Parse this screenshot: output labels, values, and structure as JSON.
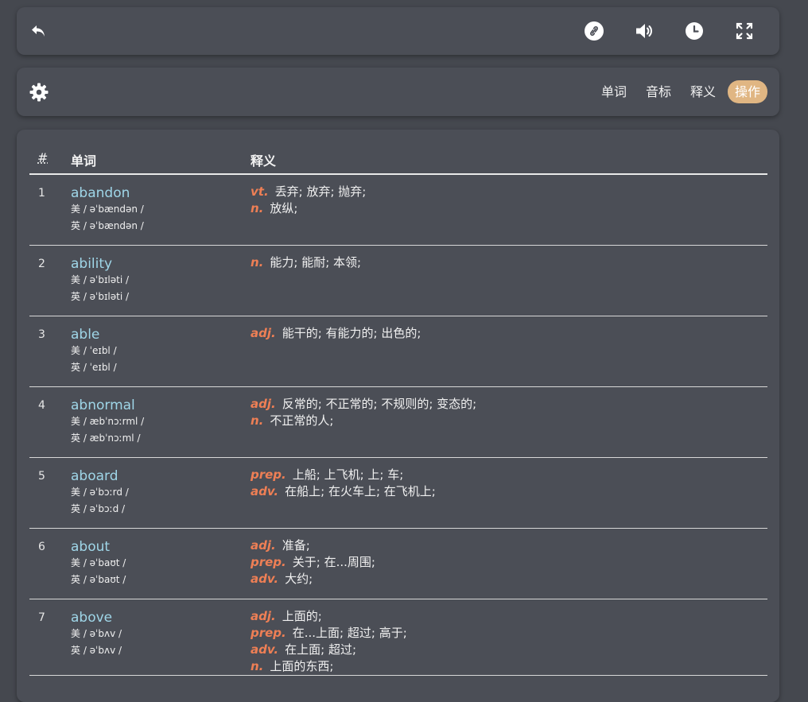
{
  "settings": {
    "tabs": [
      "单词",
      "音标",
      "释义",
      "操作"
    ],
    "active_tab": 3,
    "accent_color": "#e0b683"
  },
  "table": {
    "headers": {
      "num": "#",
      "word": "单词",
      "definition": "释义"
    },
    "rows": [
      {
        "num": "1",
        "word": "abandon",
        "us": "美 / əˈbændən /",
        "uk": "英 / əˈbændən /",
        "defs": [
          {
            "pos": "vt.",
            "text": "丢弃; 放弃; 抛弃;"
          },
          {
            "pos": "n.",
            "text": "放纵;"
          }
        ]
      },
      {
        "num": "2",
        "word": "ability",
        "us": "美 / əˈbɪləti /",
        "uk": "英 / əˈbɪləti /",
        "defs": [
          {
            "pos": "n.",
            "text": "能力; 能耐; 本领;"
          }
        ]
      },
      {
        "num": "3",
        "word": "able",
        "us": "美 / ˈeɪbl /",
        "uk": "英 / ˈeɪbl /",
        "defs": [
          {
            "pos": "adj.",
            "text": "能干的; 有能力的; 出色的;"
          }
        ]
      },
      {
        "num": "4",
        "word": "abnormal",
        "us": "美 / æbˈnɔːrml /",
        "uk": "英 / æbˈnɔːml /",
        "defs": [
          {
            "pos": "adj.",
            "text": "反常的; 不正常的; 不规则的; 变态的;"
          },
          {
            "pos": "n.",
            "text": "不正常的人;"
          }
        ]
      },
      {
        "num": "5",
        "word": "aboard",
        "us": "美 / əˈbɔːrd /",
        "uk": "英 / əˈbɔːd /",
        "defs": [
          {
            "pos": "prep.",
            "text": "上船; 上飞机; 上; 车;"
          },
          {
            "pos": "adv.",
            "text": "在船上; 在火车上; 在飞机上;"
          }
        ]
      },
      {
        "num": "6",
        "word": "about",
        "us": "美 / əˈbaʊt /",
        "uk": "英 / əˈbaʊt /",
        "defs": [
          {
            "pos": "adj.",
            "text": "准备;"
          },
          {
            "pos": "prep.",
            "text": "关于; 在...周围;"
          },
          {
            "pos": "adv.",
            "text": "大约;"
          }
        ]
      },
      {
        "num": "7",
        "word": "above",
        "us": "美 / əˈbʌv /",
        "uk": "英 / əˈbʌv /",
        "defs": [
          {
            "pos": "adj.",
            "text": "上面的;"
          },
          {
            "pos": "prep.",
            "text": "在...上面; 超过; 高于;"
          },
          {
            "pos": "adv.",
            "text": "在上面; 超过;"
          },
          {
            "pos": "n.",
            "text": "上面的东西;"
          }
        ]
      }
    ]
  }
}
